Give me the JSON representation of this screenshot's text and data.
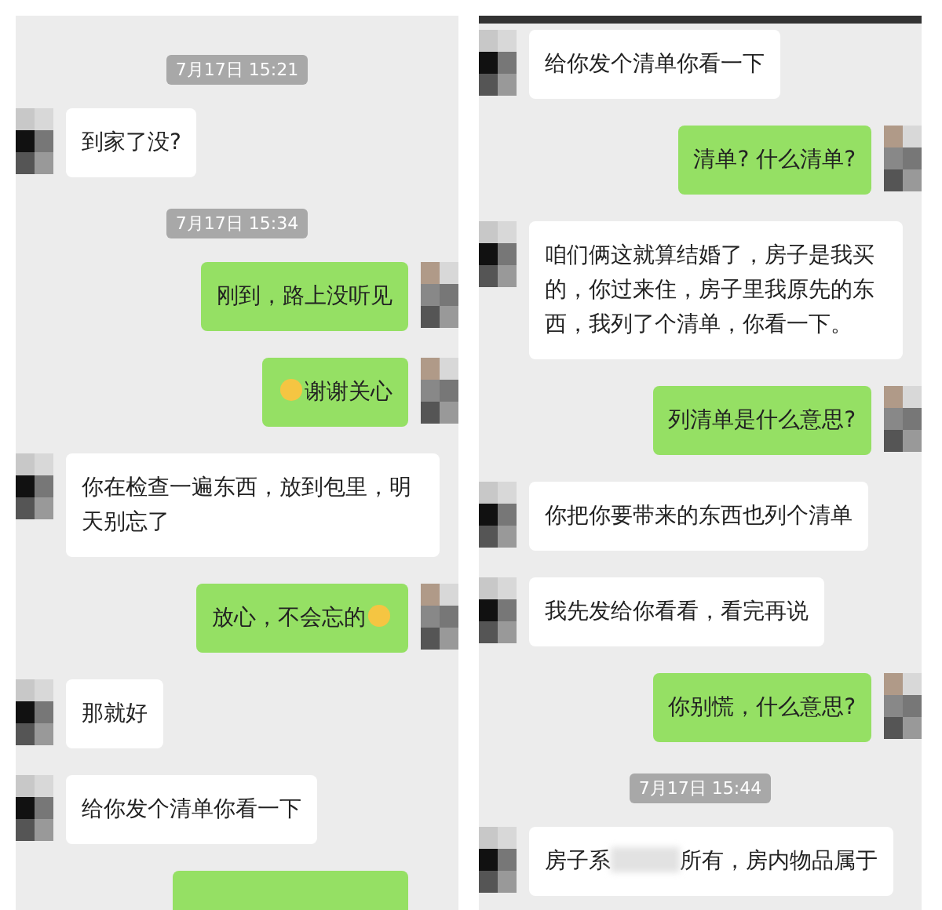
{
  "panels": [
    {
      "top_bar": false,
      "messages": [
        {
          "kind": "time",
          "text": "7月17日 15:21"
        },
        {
          "kind": "received",
          "parts": [
            {
              "kind": "text",
              "text": "到家了没?"
            }
          ]
        },
        {
          "kind": "time",
          "text": "7月17日 15:34"
        },
        {
          "kind": "sent",
          "parts": [
            {
              "kind": "text",
              "text": "刚到，路上没听见"
            }
          ]
        },
        {
          "kind": "sent",
          "parts": [
            {
              "kind": "emoji"
            },
            {
              "kind": "text",
              "text": "谢谢关心"
            }
          ]
        },
        {
          "kind": "received",
          "parts": [
            {
              "kind": "text",
              "text": "你在检查一遍东西，放到包里，明天别忘了"
            }
          ]
        },
        {
          "kind": "sent",
          "parts": [
            {
              "kind": "text",
              "text": "放心，不会忘的"
            },
            {
              "kind": "emoji"
            }
          ]
        },
        {
          "kind": "received",
          "parts": [
            {
              "kind": "text",
              "text": "那就好"
            }
          ]
        },
        {
          "kind": "received",
          "parts": [
            {
              "kind": "text",
              "text": "给你发个清单你看一下"
            }
          ]
        },
        {
          "kind": "stub"
        }
      ]
    },
    {
      "top_bar": true,
      "messages": [
        {
          "kind": "received",
          "parts": [
            {
              "kind": "text",
              "text": "给你发个清单你看一下"
            }
          ]
        },
        {
          "kind": "sent",
          "parts": [
            {
              "kind": "text",
              "text": "清单? 什么清单?"
            }
          ]
        },
        {
          "kind": "received",
          "parts": [
            {
              "kind": "text",
              "text": "咱们俩这就算结婚了，房子是我买的，你过来住，房子里我原先的东西，我列了个清单，你看一下。"
            }
          ]
        },
        {
          "kind": "sent",
          "parts": [
            {
              "kind": "text",
              "text": "列清单是什么意思?"
            }
          ]
        },
        {
          "kind": "received",
          "parts": [
            {
              "kind": "text",
              "text": "你把你要带来的东西也列个清单"
            }
          ]
        },
        {
          "kind": "received",
          "parts": [
            {
              "kind": "text",
              "text": "我先发给你看看，看完再说"
            }
          ]
        },
        {
          "kind": "sent",
          "parts": [
            {
              "kind": "text",
              "text": "你别慌，什么意思?"
            }
          ]
        },
        {
          "kind": "time",
          "text": "7月17日 15:44"
        },
        {
          "kind": "received",
          "parts": [
            {
              "kind": "text",
              "text": "房子系"
            },
            {
              "kind": "blur"
            },
            {
              "kind": "text",
              "text": "所有，房内物品属于"
            }
          ]
        }
      ]
    }
  ]
}
